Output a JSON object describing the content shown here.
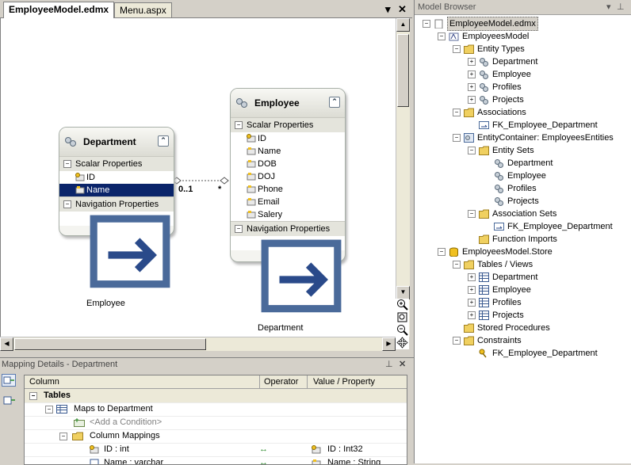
{
  "tabs": [
    {
      "label": "EmployeeModel.edmx",
      "active": true
    },
    {
      "label": "Menu.aspx",
      "active": false
    }
  ],
  "designer": {
    "entities": {
      "department": {
        "title": "Department",
        "scalar_header": "Scalar Properties",
        "scalar": [
          "ID",
          "Name"
        ],
        "selected": "Name",
        "nav_header": "Navigation Properties",
        "nav": [
          "Employee"
        ]
      },
      "employee": {
        "title": "Employee",
        "scalar_header": "Scalar Properties",
        "scalar": [
          "ID",
          "Name",
          "DOB",
          "DOJ",
          "Phone",
          "Email",
          "Salery"
        ],
        "nav_header": "Navigation Properties",
        "nav": [
          "Department"
        ]
      }
    },
    "association": {
      "left_mult": "0..1",
      "right_mult": "*"
    },
    "zoom_icons": [
      "zoom-in-icon",
      "zoom-fit-icon",
      "zoom-out-icon",
      "pan-icon"
    ]
  },
  "model_browser": {
    "title": "Model Browser",
    "root": "EmployeeModel.edmx",
    "model": "EmployeesModel",
    "entity_types_label": "Entity Types",
    "entity_types": [
      "Department",
      "Employee",
      "Profiles",
      "Projects"
    ],
    "associations_label": "Associations",
    "associations": [
      "FK_Employee_Department"
    ],
    "container": "EntityContainer: EmployeesEntities",
    "entity_sets_label": "Entity Sets",
    "entity_sets": [
      "Department",
      "Employee",
      "Profiles",
      "Projects"
    ],
    "association_sets_label": "Association Sets",
    "association_sets": [
      "FK_Employee_Department"
    ],
    "function_imports": "Function Imports",
    "store": "EmployeesModel.Store",
    "tables_label": "Tables / Views",
    "tables": [
      "Department",
      "Employee",
      "Profiles",
      "Projects"
    ],
    "stored_procedures": "Stored Procedures",
    "constraints_label": "Constraints",
    "constraints": [
      "FK_Employee_Department"
    ]
  },
  "mapping": {
    "title": "Mapping Details - Department",
    "columns": [
      "Column",
      "Operator",
      "Value / Property"
    ],
    "tables_label": "Tables",
    "maps_to": "Maps to Department",
    "add_condition": "<Add a Condition>",
    "column_mappings": "Column Mappings",
    "rows": [
      {
        "column": "ID : int",
        "operator": "↔",
        "value": "ID : Int32"
      },
      {
        "column": "Name : varchar",
        "operator": "↔",
        "value": "Name : String"
      }
    ]
  },
  "colors": {
    "selection": "#0a246a",
    "panel": "#d4d0c8",
    "operator_green": "#2a8a2a"
  }
}
